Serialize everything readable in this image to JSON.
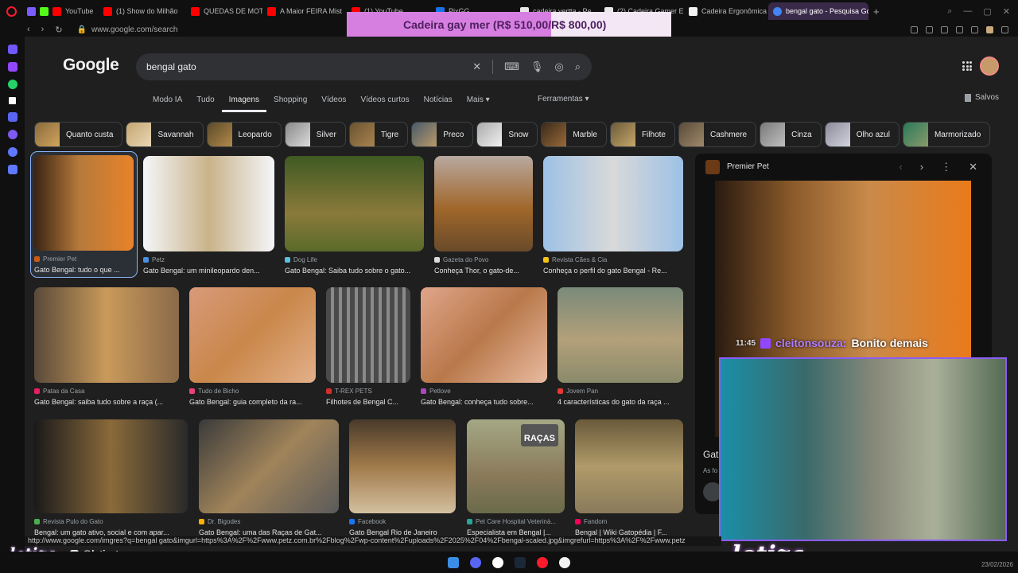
{
  "browser": {
    "tabs": [
      {
        "label": "YouTube",
        "color": "#ff0000"
      },
      {
        "label": "(1) Show do Milhão",
        "color": "#ff0000"
      },
      {
        "label": "QUEDAS DE MOTO",
        "color": "#ff0000"
      },
      {
        "label": "A Maior FEIRA Mist",
        "color": "#ff0000"
      },
      {
        "label": "(1) YouTube",
        "color": "#ff0000"
      },
      {
        "label": "PixGG",
        "color": "#1a73e8"
      },
      {
        "label": "cadeira vertta - Pe",
        "color": "#e8e8e8"
      },
      {
        "label": "(2) Cadeira Gamer E",
        "color": "#e8e8e8"
      },
      {
        "label": "Cadeira Ergonômica",
        "color": "#f2f2f2"
      },
      {
        "label": "bengal gato - Pesquisa Go",
        "color": "#4285f4",
        "active": true
      }
    ],
    "url": "www.google.com/search"
  },
  "promo": {
    "text_a": "Cadeira gay mer (R$ 510,00/",
    "text_b": "R$ 800,00)"
  },
  "google": {
    "logo": "Google",
    "query": "bengal gato",
    "tabs": [
      "Modo IA",
      "Tudo",
      "Imagens",
      "Shopping",
      "Vídeos",
      "Vídeos curtos",
      "Notícias",
      "Mais ▾"
    ],
    "active_tab": "Imagens",
    "tools": "Ferramentas ▾",
    "saved": "Salvos",
    "chips": [
      "Quanto custa",
      "Savannah",
      "Leopardo",
      "Silver",
      "Tigre",
      "Preco",
      "Snow",
      "Marble",
      "Filhote",
      "Cashmere",
      "Cinza",
      "Olho azul",
      "Marmorizado"
    ]
  },
  "results": [
    {
      "source": "Premier Pet",
      "title": "Gato Bengal: tudo o que ...",
      "color": "#c95a16"
    },
    {
      "source": "Petz",
      "title": "Gato Bengal: um minileopardo den...",
      "color": "#4a90e2"
    },
    {
      "source": "Dog Life",
      "title": "Gato Bengal: Saiba tudo sobre o gato...",
      "color": "#5bc0de"
    },
    {
      "source": "Gazeta do Povo",
      "title": "Conheça Thor, o gato-de...",
      "color": "#dddddd"
    },
    {
      "source": "Revista Cães & Cia",
      "title": "Conheça o perfil do gato Bengal - Re...",
      "color": "#f5c518"
    },
    {
      "source": "Patas da Casa",
      "title": "Gato Bengal: saiba tudo sobre a raça (...",
      "color": "#e91e63"
    },
    {
      "source": "Tudo de Bicho",
      "title": "Gato Bengal: guia completo da ra...",
      "color": "#ec407a"
    },
    {
      "source": "T-REX PETS",
      "title": "Filhotes de Bengal C...",
      "color": "#d32f2f"
    },
    {
      "source": "Petlove",
      "title": "Gato Bengal: conheça tudo sobre...",
      "color": "#ab47bc"
    },
    {
      "source": "Jovem Pan",
      "title": "4 características do gato da raça ...",
      "color": "#e53935"
    },
    {
      "source": "Revista Pulo do Gato",
      "title": "Bengal: um gato ativo, social e com apar...",
      "color": "#4caf50"
    },
    {
      "source": "Dr. Bigodes",
      "title": "Gato Bengal: uma das Raças de Gat...",
      "color": "#ffb300"
    },
    {
      "source": "Facebook",
      "title": "Gato Bengal Rio de Janeiro",
      "color": "#1877f2"
    },
    {
      "source": "Pet Care Hospital Veterinà...",
      "title": "Especialista em Bengal |...",
      "color": "#26a69a"
    },
    {
      "source": "Fandom",
      "title": "Bengal | Wiki Gatopédia | F...",
      "color": "#fa005a"
    }
  ],
  "badge_text": "RAÇAS",
  "preview": {
    "source": "Premier Pet",
    "bottom_title": "Gat",
    "bottom_sub": "As fo"
  },
  "chat": {
    "time": "11:45",
    "user": "cleitonsouza:",
    "message": "Bonito demais"
  },
  "statusbar": {
    "url": "http://www.google.com/imgres?q=bengal gato&imgurl=https%3A%2F%2Fwww.petz.com.br%2Fblog%2Fwp-content%2Fuploads%2F2025%2F04%2Fbengal-scaled.jpg&imgrefurl=https%3A%2F%2Fwww.petz"
  },
  "stream": {
    "brand": "letiza",
    "handle": "@letizatv"
  },
  "clock": "23/02/2026"
}
